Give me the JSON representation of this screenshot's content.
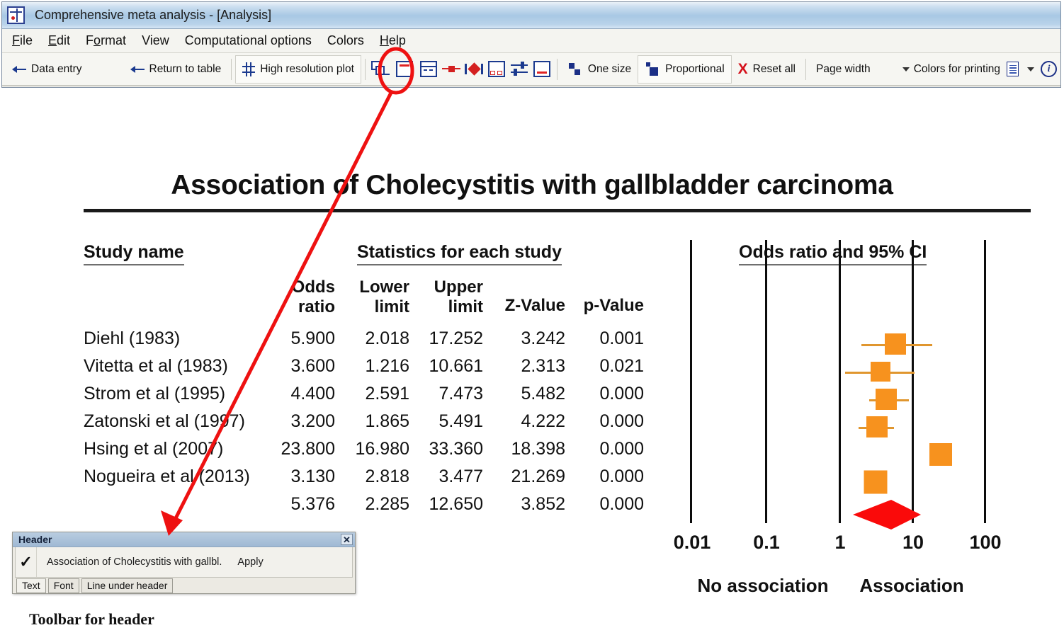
{
  "window": {
    "title": "Comprehensive meta analysis - [Analysis]",
    "app_icon": "cma-app-icon"
  },
  "menu": {
    "items": [
      {
        "label": "File",
        "mnemonic": "F",
        "pre": "",
        "post": "ile"
      },
      {
        "label": "Edit",
        "mnemonic": "E",
        "pre": "",
        "post": "dit"
      },
      {
        "label": "Format",
        "mnemonic": "o",
        "pre": "F",
        "post": "rmat"
      },
      {
        "label": "View",
        "mnemonic": "V",
        "pre": "",
        "post": "iew"
      },
      {
        "label": "Computational options",
        "mnemonic": "C",
        "pre": "",
        "post": "omputational options"
      },
      {
        "label": "Colors",
        "mnemonic": "C",
        "pre": "",
        "post": "olors"
      },
      {
        "label": "Help",
        "mnemonic": "H",
        "pre": "",
        "post": "elp"
      }
    ]
  },
  "toolbar": {
    "data_entry": "Data entry",
    "return_to_table": "Return to table",
    "high_resolution_plot": "High resolution plot",
    "one_size": "One size",
    "proportional": "Proportional",
    "reset_all": "Reset all",
    "page_width": "Page width",
    "colors_for_printing": "Colors for printing",
    "reset_glyph": "X",
    "info_glyph": "i",
    "icons": [
      "split-panel-icon",
      "header-band-icon",
      "column-header-icon",
      "point-marker-icon",
      "diamond-marker-icon",
      "footer-boxes-icon",
      "axis-scale-icon",
      "footer-band-icon"
    ]
  },
  "annotations": {
    "highlight_icon": "header-band-icon",
    "arrow_color": "#ee1111",
    "caption": "Toolbar for header"
  },
  "header_dialog": {
    "title": "Header",
    "close_label": "✕",
    "checkbox_checked": true,
    "check_glyph": "✓",
    "text_value": "Association of Cholecystitis with gallbl.",
    "apply_label": "Apply",
    "tabs": [
      {
        "label": "Text",
        "active": true
      },
      {
        "label": "Font",
        "active": false
      },
      {
        "label": "Line under header",
        "active": false
      }
    ]
  },
  "chart_data": {
    "type": "table",
    "plot_type": "forest",
    "title": "Association of Cholecystitis with gallbladder carcinoma",
    "group_headers": {
      "study": "Study name",
      "stats": "Statistics for each study",
      "plot": "Odds ratio and 95% CI"
    },
    "columns": [
      {
        "key": "study",
        "label_line1": "",
        "label_line2": ""
      },
      {
        "key": "odds_ratio",
        "label_line1": "Odds",
        "label_line2": "ratio"
      },
      {
        "key": "lower_limit",
        "label_line1": "Lower",
        "label_line2": "limit"
      },
      {
        "key": "upper_limit",
        "label_line1": "Upper",
        "label_line2": "limit"
      },
      {
        "key": "z_value",
        "label_line1": "",
        "label_line2": "Z-Value"
      },
      {
        "key": "p_value",
        "label_line1": "",
        "label_line2": "p-Value"
      }
    ],
    "rows": [
      {
        "study": "Diehl (1983)",
        "odds_ratio": "5.900",
        "lower_limit": "2.018",
        "upper_limit": "17.252",
        "z_value": "3.242",
        "p_value": "0.001",
        "or": 5.9,
        "ll": 2.018,
        "ul": 17.252,
        "marker": 30,
        "summary": false
      },
      {
        "study": "Vitetta et al (1983)",
        "odds_ratio": "3.600",
        "lower_limit": "1.216",
        "upper_limit": "10.661",
        "z_value": "2.313",
        "p_value": "0.021",
        "or": 3.6,
        "ll": 1.216,
        "ul": 10.661,
        "marker": 28,
        "summary": false
      },
      {
        "study": "Strom et al (1995)",
        "odds_ratio": "4.400",
        "lower_limit": "2.591",
        "upper_limit": "7.473",
        "z_value": "5.482",
        "p_value": "0.000",
        "or": 4.4,
        "ll": 2.591,
        "ul": 7.473,
        "marker": 30,
        "summary": false
      },
      {
        "study": "Zatonski et al (1997)",
        "odds_ratio": "3.200",
        "lower_limit": "1.865",
        "upper_limit": "5.491",
        "z_value": "4.222",
        "p_value": "0.000",
        "or": 3.2,
        "ll": 1.865,
        "ul": 5.491,
        "marker": 30,
        "summary": false
      },
      {
        "study": "Hsing et al (2007)",
        "odds_ratio": "23.800",
        "lower_limit": "16.980",
        "upper_limit": "33.360",
        "z_value": "18.398",
        "p_value": "0.000",
        "or": 23.8,
        "ll": 16.98,
        "ul": 33.36,
        "marker": 32,
        "summary": false
      },
      {
        "study": "Nogueira et al (2013)",
        "odds_ratio": "3.130",
        "lower_limit": "2.818",
        "upper_limit": "3.477",
        "z_value": "21.269",
        "p_value": "0.000",
        "or": 3.13,
        "ll": 2.818,
        "ul": 3.477,
        "marker": 33,
        "summary": false
      },
      {
        "study": "",
        "odds_ratio": "5.376",
        "lower_limit": "2.285",
        "upper_limit": "12.650",
        "z_value": "3.852",
        "p_value": "0.000",
        "or": 5.376,
        "ll": 2.285,
        "ul": 12.65,
        "marker": 0,
        "summary": true
      }
    ],
    "axis": {
      "scale": "log",
      "ticks": [
        "0.01",
        "0.1",
        "1",
        "10",
        "100"
      ],
      "tick_values": [
        0.01,
        0.1,
        1,
        10,
        100
      ],
      "left_label": "No association",
      "right_label": "Association"
    },
    "colors": {
      "marker": "#f7921e",
      "ci_line": "#e0962e",
      "summary_diamond": "#fa0a0a",
      "axis": "#0c0c0c",
      "text": "#111111"
    }
  }
}
